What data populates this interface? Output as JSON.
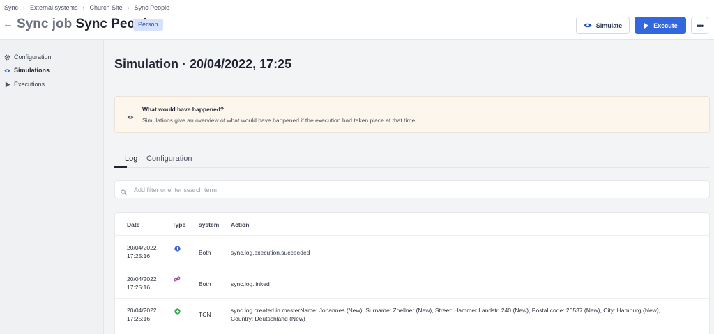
{
  "breadcrumb": [
    "Sync",
    "External systems",
    "Church Site",
    "Sync People"
  ],
  "header": {
    "title_prefix": "Sync job",
    "title_name": "Sync People",
    "badge": "Person",
    "simulate_label": "Simulate",
    "execute_label": "Execute",
    "more_label": "•••"
  },
  "sidebar": {
    "items": [
      {
        "label": "Configuration",
        "icon": "gear-icon",
        "active": false
      },
      {
        "label": "Simulations",
        "icon": "eye-icon",
        "active": true
      },
      {
        "label": "Executions",
        "icon": "play-icon",
        "active": false
      }
    ]
  },
  "main": {
    "page_title": "Simulation · 20/04/2022, 17:25",
    "info": {
      "title": "What would have happened?",
      "text": "Simulations give an overview of what would have happened if the execution had taken place at that time"
    },
    "tabs": [
      {
        "label": "Log",
        "active": true
      },
      {
        "label": "Configuration",
        "active": false
      }
    ],
    "search": {
      "placeholder": "Add filter or enter search term",
      "value": ""
    },
    "table": {
      "headers": {
        "date": "Date",
        "type": "Type",
        "system": "system",
        "action": "Action"
      },
      "rows": [
        {
          "date": "20/04/2022",
          "time": "17:25:16",
          "type_icon": "info-icon",
          "system": "Both",
          "action": "sync.log.execution.succeeded"
        },
        {
          "date": "20/04/2022",
          "time": "17:25:16",
          "type_icon": "link-icon",
          "system": "Both",
          "action": "sync.log.linked"
        },
        {
          "date": "20/04/2022",
          "time": "17:25:16",
          "type_icon": "plus-circle-icon",
          "system": "TCN",
          "action": "sync.log.created.in.masterName: Johannes (New), Surname: Zoellner (New), Street: Hammer Landstr. 240 (New), Postal code: 20537 (New), City: Hamburg (New), Country: Deutschland (New)"
        }
      ]
    }
  },
  "colors": {
    "accent": "#3367e0",
    "badge_bg": "#d6e2fb",
    "info_bg": "#fdf6ec",
    "info_icon": "#3f63c7",
    "link_icon": "#a3479b",
    "success_icon": "#3fa45a"
  }
}
